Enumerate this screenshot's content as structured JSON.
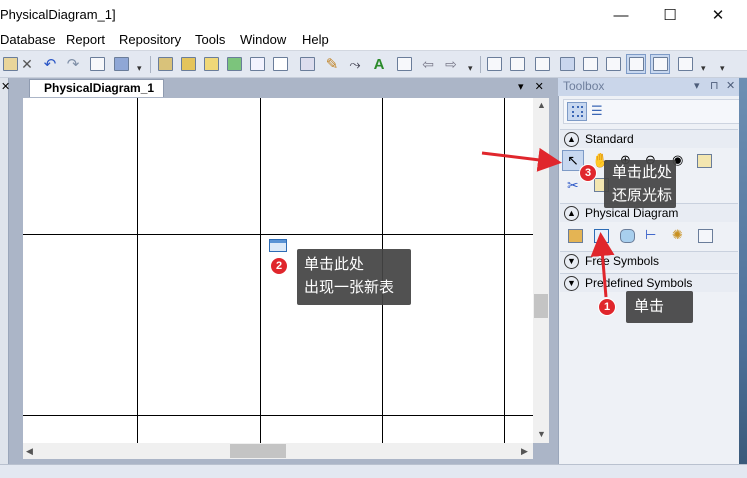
{
  "window": {
    "title": "PhysicalDiagram_1]"
  },
  "window_controls": {
    "minimize": "—",
    "maximize": "☐",
    "close": "✕"
  },
  "menu": [
    "Database",
    "Report",
    "Repository",
    "Tools",
    "Window",
    "Help"
  ],
  "document": {
    "tab_label": "PhysicalDiagram_1",
    "dropdown": "▾",
    "close": "✕"
  },
  "toolbox": {
    "title": "Toolbox",
    "header_controls": {
      "dropdown": "▾",
      "pin": "⊓",
      "close": "✕"
    },
    "sections": [
      {
        "label": "Standard",
        "state": "expanded"
      },
      {
        "label": "Physical Diagram",
        "state": "expanded"
      },
      {
        "label": "Free Symbols",
        "state": "collapsed"
      },
      {
        "label": "Predefined Symbols",
        "state": "collapsed"
      }
    ]
  },
  "annotations": {
    "step1": {
      "number": "1",
      "text": "单击"
    },
    "step2": {
      "number": "2",
      "line1": "单击此处",
      "line2": "出现一张新表"
    },
    "step3": {
      "number": "3",
      "line1": "单击此处",
      "line2": "还原光标"
    }
  },
  "colors": {
    "accent_red": "#e0262c",
    "callout_bg": "#444444",
    "toolbar": "#e3e8f1",
    "toolbox_header": "#cad6ea"
  }
}
